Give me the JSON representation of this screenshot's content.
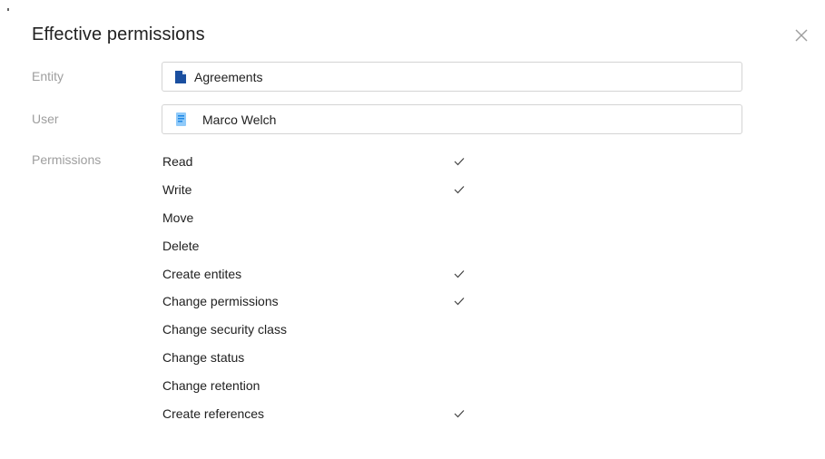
{
  "dialog": {
    "title": "Effective permissions",
    "close_icon": "close-icon"
  },
  "entity": {
    "label": "Entity",
    "value": "Agreements",
    "icon": "document-icon",
    "icon_color": "#1a4fa0"
  },
  "user": {
    "label": "User",
    "value": "Marco Welch",
    "icon": "user-card-icon",
    "icon_color": "#64b5f6"
  },
  "permissions": {
    "label": "Permissions",
    "items": [
      {
        "name": "Read",
        "granted": true
      },
      {
        "name": "Write",
        "granted": true
      },
      {
        "name": "Move",
        "granted": false
      },
      {
        "name": "Delete",
        "granted": false
      },
      {
        "name": "Create entites",
        "granted": true
      },
      {
        "name": "Change permissions",
        "granted": true
      },
      {
        "name": "Change security class",
        "granted": false
      },
      {
        "name": "Change status",
        "granted": false
      },
      {
        "name": "Change retention",
        "granted": false
      },
      {
        "name": "Create references",
        "granted": true
      }
    ]
  }
}
